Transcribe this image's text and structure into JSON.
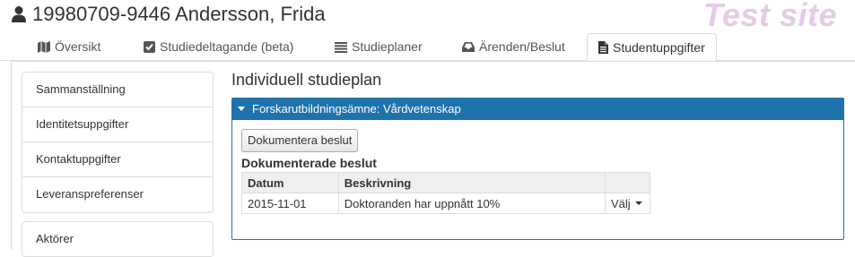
{
  "header": {
    "person_name": "19980709-9446 Andersson, Frida",
    "site_label": "Test site"
  },
  "tabs": [
    {
      "label": "Översikt",
      "icon": "map-icon",
      "active": false
    },
    {
      "label": "Studiedeltagande (beta)",
      "icon": "checkbox-icon",
      "active": false
    },
    {
      "label": "Studieplaner",
      "icon": "list-icon",
      "active": false
    },
    {
      "label": "Ärenden/Beslut",
      "icon": "inbox-icon",
      "active": false
    },
    {
      "label": "Studentuppgifter",
      "icon": "document-icon",
      "active": true
    }
  ],
  "sidebar": {
    "group1": [
      "Sammanställning",
      "Identitetsuppgifter",
      "Kontaktuppgifter",
      "Leveranspreferenser"
    ],
    "group2": [
      "Aktörer"
    ]
  },
  "main": {
    "title": "Individuell studieplan",
    "panel_title": "Forskarutbildningsämne: Vårdvetenskap",
    "document_button": "Dokumentera beslut",
    "section_title": "Dokumenterade beslut",
    "table": {
      "headers": [
        "Datum",
        "Beskrivning",
        ""
      ],
      "rows": [
        {
          "datum": "2015-11-01",
          "beskrivning": "Doktoranden har uppnått 10%",
          "action": "Välj"
        }
      ]
    }
  },
  "colors": {
    "panel_header": "#1f73ad",
    "site_label": "#e4cce6"
  }
}
